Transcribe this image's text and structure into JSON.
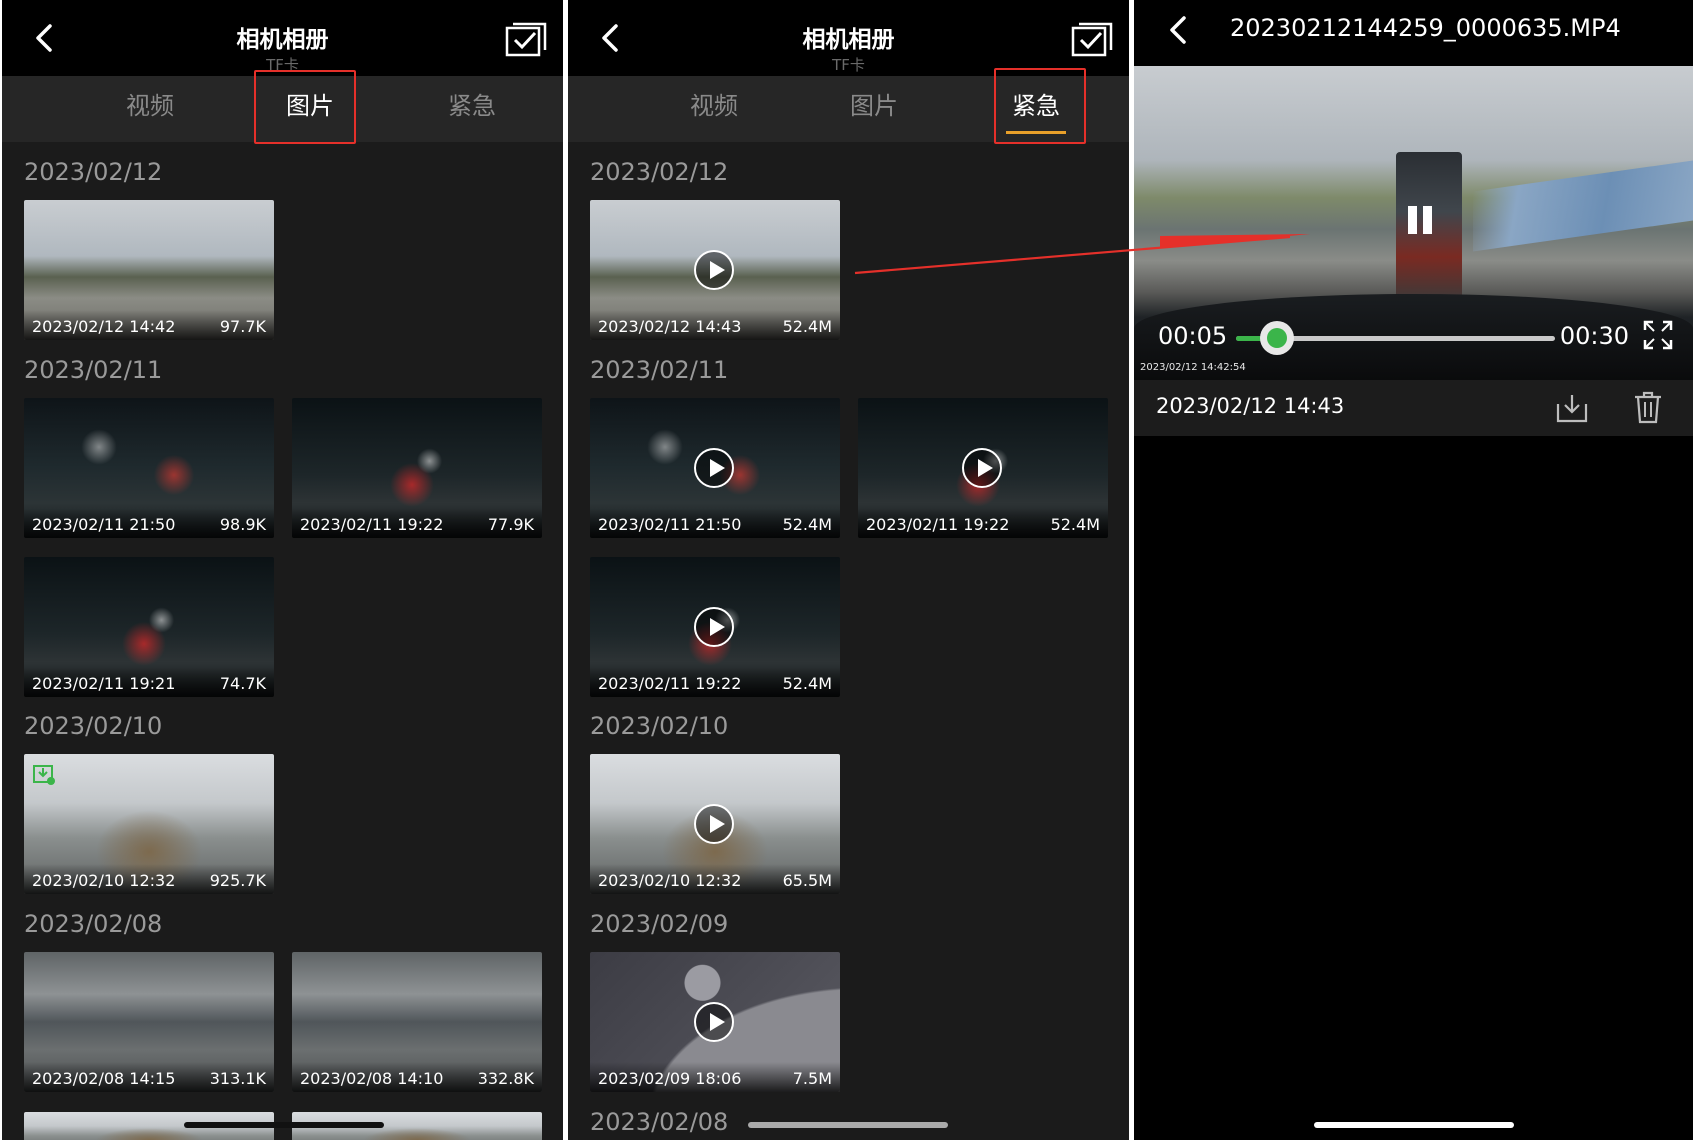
{
  "panels": [
    {
      "header": {
        "title": "相机相册",
        "subtitle": "TF卡"
      },
      "tabs": [
        {
          "label": "视频"
        },
        {
          "label": "图片"
        },
        {
          "label": "紧急"
        }
      ],
      "active_tab": "图片",
      "groups": [
        {
          "date": "2023/02/12",
          "items": [
            {
              "date": "2023/02/12 14:42",
              "size": "97.7K"
            }
          ]
        },
        {
          "date": "2023/02/11",
          "items": [
            {
              "date": "2023/02/11 21:50",
              "size": "98.9K"
            },
            {
              "date": "2023/02/11 19:22",
              "size": "77.9K"
            },
            {
              "date": "2023/02/11 19:21",
              "size": "74.7K"
            }
          ]
        },
        {
          "date": "2023/02/10",
          "items": [
            {
              "date": "2023/02/10 12:32",
              "size": "925.7K"
            }
          ]
        },
        {
          "date": "2023/02/08",
          "items": [
            {
              "date": "2023/02/08 14:15",
              "size": "313.1K"
            },
            {
              "date": "2023/02/08 14:10",
              "size": "332.8K"
            }
          ]
        }
      ]
    },
    {
      "header": {
        "title": "相机相册",
        "subtitle": "TF卡"
      },
      "tabs": [
        {
          "label": "视频"
        },
        {
          "label": "图片"
        },
        {
          "label": "紧急"
        }
      ],
      "active_tab": "紧急",
      "groups": [
        {
          "date": "2023/02/12",
          "items": [
            {
              "date": "2023/02/12 14:43",
              "size": "52.4M"
            }
          ]
        },
        {
          "date": "2023/02/11",
          "items": [
            {
              "date": "2023/02/11 21:50",
              "size": "52.4M"
            },
            {
              "date": "2023/02/11 19:22",
              "size": "52.4M"
            },
            {
              "date": "2023/02/11 19:22",
              "size": "52.4M"
            }
          ]
        },
        {
          "date": "2023/02/10",
          "items": [
            {
              "date": "2023/02/10 12:32",
              "size": "65.5M"
            }
          ]
        },
        {
          "date": "2023/02/09",
          "items": [
            {
              "date": "2023/02/09 18:06",
              "size": "7.5M"
            }
          ]
        },
        {
          "date": "2023/02/08",
          "items": []
        }
      ]
    }
  ],
  "player": {
    "title": "20230212144259_0000635.MP4",
    "current_time": "00:05",
    "total_time": "00:30",
    "progress": 0.128,
    "osd_timestamp": "2023/02/12  14:42:54",
    "file_date": "2023/02/12 14:43"
  },
  "colors": {
    "highlight_box": "#e5302a",
    "progress": "#3bb54a",
    "tab_underline": "#e8a02a"
  },
  "icons": [
    "back-icon",
    "select-all-icon",
    "play-icon",
    "pause-icon",
    "fullscreen-icon",
    "download-icon",
    "delete-icon",
    "downloaded-badge-icon"
  ]
}
